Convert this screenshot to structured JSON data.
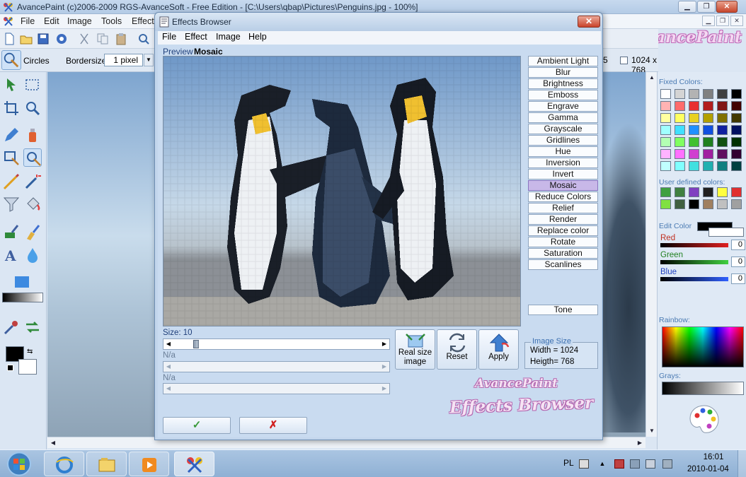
{
  "app": {
    "title": "AvancePaint (c)2006-2009 RGS-AvanceSoft - Free Edition - [C:\\Users\\qbap\\Pictures\\Penguins.jpg - 100%]",
    "menu": [
      "File",
      "Edit",
      "Image",
      "Tools",
      "Effects"
    ],
    "brand": "AvancePaint"
  },
  "options": {
    "tool_name": "Circles",
    "bordersize_label": "Bordersize:",
    "bordersize_value": "1 pixel",
    "number_5": "5",
    "resolution": "1024 x 768"
  },
  "palette": {
    "fixed_label": "Fixed Colors:",
    "user_label": "User defined colors:",
    "edit_label": "Edit Color",
    "red_label": "Red",
    "red_value": "0",
    "green_label": "Green",
    "green_value": "0",
    "blue_label": "Blue",
    "blue_value": "0",
    "rainbow_label": "Rainbow:",
    "grays_label": "Grays:",
    "fixed_colors": [
      "#ffffff",
      "#d4d4d4",
      "#b3b3b3",
      "#808080",
      "#404040",
      "#000000",
      "#ffb3b3",
      "#ff6b6b",
      "#e83030",
      "#b31d1d",
      "#801515",
      "#400000",
      "#ffffa0",
      "#ffff60",
      "#e8d020",
      "#b3a000",
      "#807000",
      "#403800",
      "#a0ffff",
      "#40e0ff",
      "#2090ff",
      "#1050e0",
      "#1020a0",
      "#001060",
      "#b3ffb3",
      "#80ff60",
      "#40c030",
      "#208020",
      "#105010",
      "#003000",
      "#ffb3ff",
      "#ff70ff",
      "#d040d0",
      "#a020a0",
      "#601060",
      "#300030",
      "#c0ffff",
      "#80ffff",
      "#40e0e0",
      "#20b0b0",
      "#108080",
      "#004040"
    ],
    "user_colors": [
      "#40a040",
      "#408040",
      "#8040c0",
      "#202020",
      "#ffff40",
      "#e03030",
      "#80e040",
      "#406040",
      "#000000",
      "#a08060",
      "#c0c0c0",
      "#a0a0a0"
    ]
  },
  "dialog": {
    "title": "Effects Browser",
    "menu": [
      "File",
      "Effect",
      "Image",
      "Help"
    ],
    "preview_label": "Preview",
    "preview_effect": "Mosaic",
    "effects": [
      "Ambient Light",
      "Blur",
      "Brightness",
      "Emboss",
      "Engrave",
      "Gamma",
      "Grayscale",
      "Gridlines",
      "Hue",
      "Inversion",
      "Invert",
      "Mosaic",
      "Reduce Colors",
      "Relief",
      "Render",
      "Replace color",
      "Rotate",
      "Saturation",
      "Scanlines"
    ],
    "extra_effect": "Tone",
    "selected_effect": "Mosaic",
    "param1_label": "Size: 10",
    "param2_label": "N/a",
    "param3_label": "N/a",
    "size_value": 10,
    "size_range": [
      0,
      100
    ],
    "btn_real_size_1": "Real size",
    "btn_real_size_2": "image",
    "btn_reset": "Reset",
    "btn_apply": "Apply",
    "image_size_legend": "Image Size",
    "image_width": "Width = 1024",
    "image_height": "Heigth= 768",
    "brand_line1": "AvancePaint",
    "brand_line2": "Effects Browser",
    "ok_symbol": "✓",
    "cancel_symbol": "✗"
  },
  "taskbar": {
    "lang": "PL",
    "time": "16:01",
    "date": "2010-01-04"
  },
  "colors": {
    "selected_effect": "#c8b8e8",
    "ok_green": "#3a9a3a",
    "cancel_red": "#d02020"
  }
}
